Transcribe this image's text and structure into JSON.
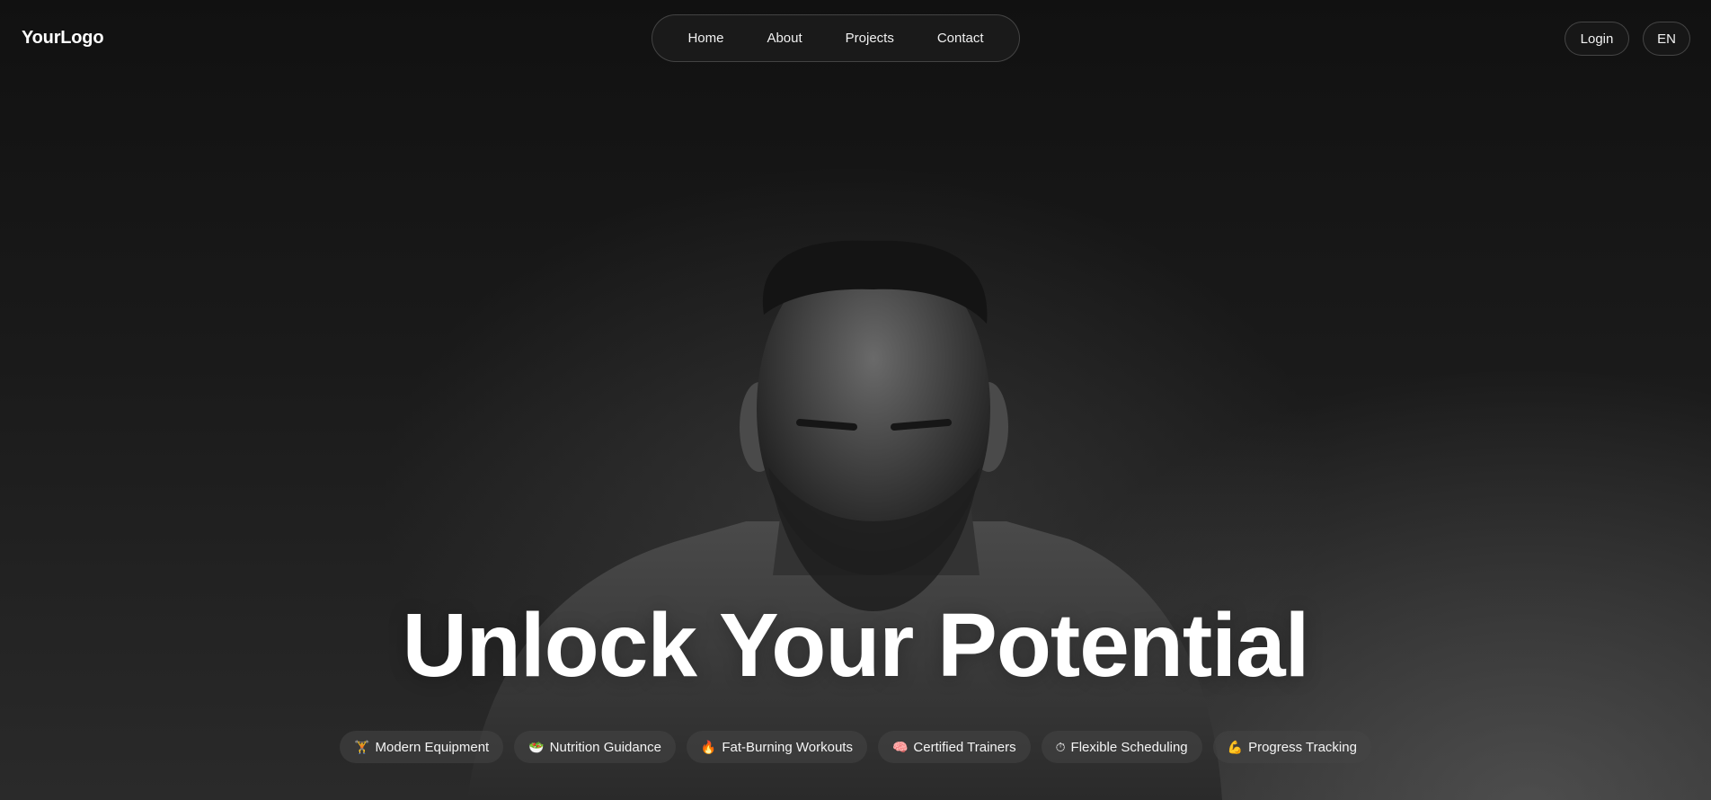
{
  "header": {
    "logo": "YourLogo",
    "nav": [
      "Home",
      "About",
      "Projects",
      "Contact"
    ],
    "login_label": "Login",
    "language_label": "EN"
  },
  "hero": {
    "headline": "Unlock Your Potential",
    "features": [
      {
        "icon": "🏋",
        "icon_name": "weightlifting-icon",
        "label": "Modern Equipment"
      },
      {
        "icon": "🥗",
        "icon_name": "salad-icon",
        "label": "Nutrition Guidance"
      },
      {
        "icon": "🔥",
        "icon_name": "fire-icon",
        "label": "Fat-Burning Workouts"
      },
      {
        "icon": "🧠",
        "icon_name": "brain-icon",
        "label": "Certified Trainers"
      },
      {
        "icon": "⏱",
        "icon_name": "stopwatch-icon",
        "label": "Flexible Scheduling"
      },
      {
        "icon": "💪",
        "icon_name": "flexed-bicep-icon",
        "label": "Progress Tracking"
      }
    ]
  },
  "colors": {
    "background": "#141414",
    "text": "#ffffff",
    "chip_background": "#464646"
  }
}
